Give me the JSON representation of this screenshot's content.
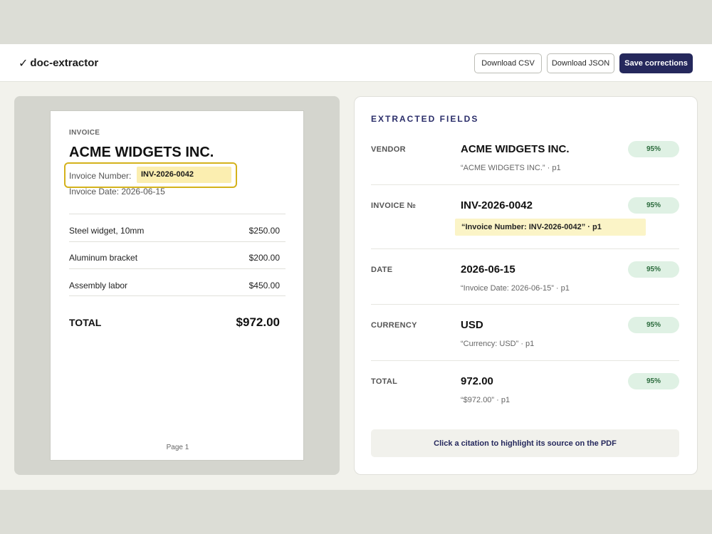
{
  "header": {
    "brand": "doc-extractor",
    "download_csv": "Download CSV",
    "download_json": "Download JSON",
    "save": "Save corrections"
  },
  "pdf": {
    "doc_type": "INVOICE",
    "vendor": "ACME WIDGETS INC.",
    "invoice_number_label": "Invoice Number:",
    "invoice_number_value": "INV-2026-0042",
    "invoice_date": "Invoice Date: 2026-06-15",
    "line_items": [
      {
        "description": "Steel widget, 10mm",
        "amount": "$250.00"
      },
      {
        "description": "Aluminum bracket",
        "amount": "$200.00"
      },
      {
        "description": "Assembly labor",
        "amount": "$450.00"
      }
    ],
    "total_label": "TOTAL",
    "total_value": "$972.00",
    "page_label": "Page 1"
  },
  "fields": {
    "heading": "EXTRACTED FIELDS",
    "items": [
      {
        "label": "VENDOR",
        "value": "ACME WIDGETS INC.",
        "citation": "“ACME WIDGETS INC.” · p1",
        "confidence": "95%",
        "active": false
      },
      {
        "label": "INVOICE №",
        "value": "INV-2026-0042",
        "citation": "“Invoice Number: INV-2026-0042” · p1",
        "confidence": "95%",
        "active": true
      },
      {
        "label": "DATE",
        "value": "2026-06-15",
        "citation": "“Invoice Date: 2026-06-15” · p1",
        "confidence": "95%",
        "active": false
      },
      {
        "label": "CURRENCY",
        "value": "USD",
        "citation": "“Currency: USD” · p1",
        "confidence": "95%",
        "active": false
      },
      {
        "label": "TOTAL",
        "value": "972.00",
        "citation": "“$972.00” · p1",
        "confidence": "95%",
        "active": false
      }
    ],
    "hint": "Click a citation to highlight its source on the PDF"
  },
  "colors": {
    "primary": "#25285c",
    "highlight": "#fbeeb0",
    "highlight_border": "#d4b21c",
    "confidence_bg": "#dff1e4",
    "confidence_text": "#2c6b3d"
  },
  "icons": {
    "brand": "check-icon"
  }
}
